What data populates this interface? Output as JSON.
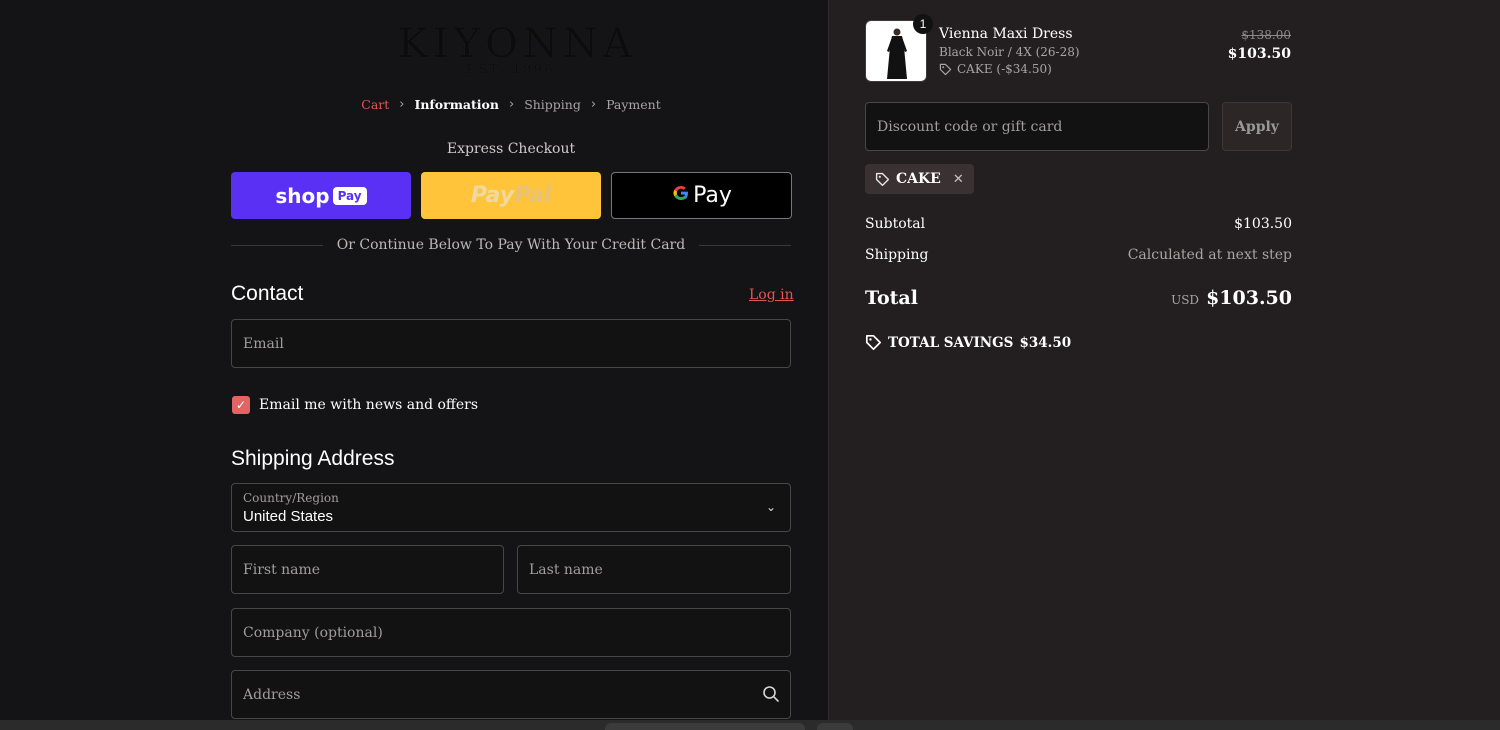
{
  "brand": {
    "name": "KIYONNA",
    "tagline": "EST. 1996"
  },
  "breadcrumb": [
    {
      "label": "Cart"
    },
    {
      "label": "Information"
    },
    {
      "label": "Shipping"
    },
    {
      "label": "Payment"
    }
  ],
  "express": {
    "title": "Express Checkout",
    "shop_pay": {
      "text": "shop",
      "chip": "Pay"
    },
    "paypal": {
      "part1": "Pay",
      "part2": "Pal"
    },
    "gpay": {
      "g": "G",
      "text": "Pay"
    }
  },
  "divider_text": "Or Continue Below To Pay With Your Credit Card",
  "contact": {
    "title": "Contact",
    "login_label": "Log in",
    "email_placeholder": "Email",
    "newsletter_label": "Email me with news and offers",
    "newsletter_checked": true
  },
  "shipping": {
    "title": "Shipping Address",
    "country_label": "Country/Region",
    "country_value": "United States",
    "first_name_placeholder": "First name",
    "last_name_placeholder": "Last name",
    "company_placeholder": "Company (optional)",
    "address_placeholder": "Address"
  },
  "order": {
    "item": {
      "quantity": "1",
      "name": "Vienna Maxi Dress",
      "variant": "Black Noir / 4X (26-28)",
      "discount": "CAKE (-$34.50)",
      "compare_price": "$138.00",
      "price": "$103.50"
    },
    "discount_placeholder": "Discount code or gift card",
    "apply_label": "Apply",
    "applied_code": "CAKE",
    "subtotal_label": "Subtotal",
    "subtotal_value": "$103.50",
    "shipping_label": "Shipping",
    "shipping_value": "Calculated at next step",
    "total_label": "Total",
    "currency": "USD",
    "total_value": "$103.50",
    "savings_label": "TOTAL SAVINGS",
    "savings_value": "$34.50"
  },
  "colors": {
    "accent": "#e25555",
    "shop_pay": "#5a31f4",
    "paypal": "#ffc439",
    "checkbox": "#e06565"
  }
}
